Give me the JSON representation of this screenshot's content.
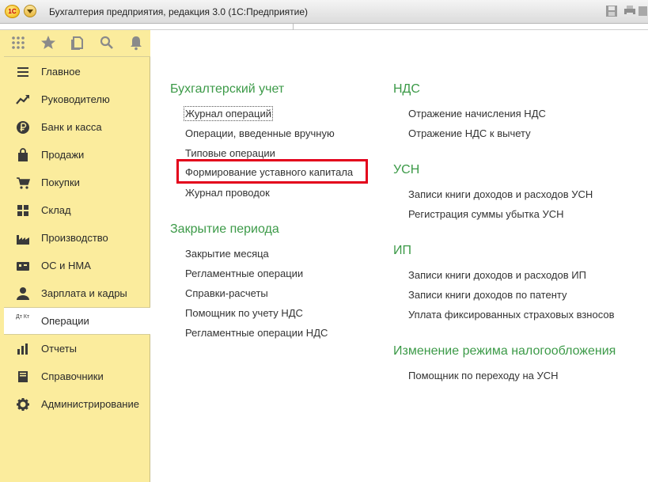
{
  "window": {
    "title": "Бухгалтерия предприятия, редакция 3.0  (1С:Предприятие)",
    "logo_text": "1С"
  },
  "sidebar": {
    "top_icons": [
      "apps-grid-icon",
      "star-icon",
      "history-icon",
      "search-icon",
      "bell-icon"
    ],
    "items": [
      {
        "label": "Главное",
        "icon": "menu-icon"
      },
      {
        "label": "Руководителю",
        "icon": "trend-icon"
      },
      {
        "label": "Банк и касса",
        "icon": "ruble-icon"
      },
      {
        "label": "Продажи",
        "icon": "bag-icon"
      },
      {
        "label": "Покупки",
        "icon": "cart-icon"
      },
      {
        "label": "Склад",
        "icon": "warehouse-icon"
      },
      {
        "label": "Производство",
        "icon": "factory-icon"
      },
      {
        "label": "ОС и НМА",
        "icon": "assets-icon"
      },
      {
        "label": "Зарплата и кадры",
        "icon": "person-icon"
      },
      {
        "label": "Операции",
        "icon": "debit-credit-icon",
        "active": true,
        "icon_text": "Дт Кт"
      },
      {
        "label": "Отчеты",
        "icon": "chart-icon"
      },
      {
        "label": "Справочники",
        "icon": "book-icon"
      },
      {
        "label": "Администрирование",
        "icon": "gear-icon"
      }
    ]
  },
  "main": {
    "left_column": {
      "accounting": {
        "title": "Бухгалтерский учет",
        "links": [
          "Журнал операций",
          "Операции, введенные вручную",
          "Типовые операции",
          "Формирование уставного капитала",
          "Журнал проводок"
        ]
      },
      "period_close": {
        "title": "Закрытие периода",
        "links": [
          "Закрытие месяца",
          "Регламентные операции",
          "Справки-расчеты",
          "Помощник по учету НДС",
          "Регламентные операции НДС"
        ]
      }
    },
    "right_column": {
      "vat": {
        "title": "НДС",
        "links": [
          "Отражение начисления НДС",
          "Отражение НДС к вычету"
        ]
      },
      "usn": {
        "title": "УСН",
        "links": [
          "Записи книги доходов и расходов УСН",
          "Регистрация суммы убытка УСН"
        ]
      },
      "ip": {
        "title": "ИП",
        "links": [
          "Записи книги доходов и расходов ИП",
          "Записи книги доходов по патенту",
          "Уплата фиксированных страховых взносов"
        ]
      },
      "tax_regime": {
        "title": "Изменение режима налогообложения",
        "links": [
          "Помощник по переходу на УСН"
        ]
      }
    },
    "highlight_color": "#e3001b",
    "section_color": "#3c9a48"
  }
}
